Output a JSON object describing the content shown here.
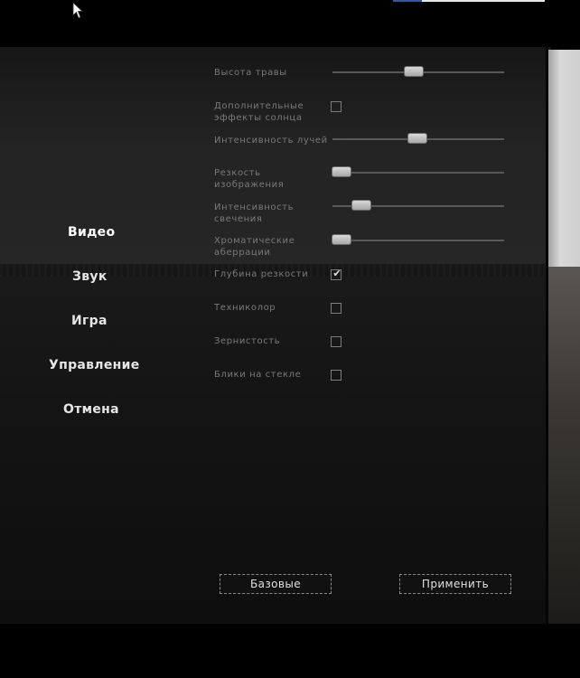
{
  "menu": {
    "items": [
      {
        "label": "Видео"
      },
      {
        "label": "Звук"
      },
      {
        "label": "Игра"
      },
      {
        "label": "Управление"
      },
      {
        "label": "Отмена"
      }
    ],
    "active": "Видео"
  },
  "settings": {
    "grass_height": {
      "label": "Высота травы",
      "value": 0.47
    },
    "sun_effects": {
      "label": "Дополнительные\nэффекты солнца",
      "checked": false
    },
    "ray_intensity": {
      "label": "Интенсивность лучей",
      "value": 0.5
    },
    "sharpness": {
      "label": "Резкость\nизображения",
      "value": 0.0
    },
    "glow_intensity": {
      "label": "Интенсивность\nсвечения",
      "value": 0.17
    },
    "chromatic_aberration": {
      "label": "Хроматические\nаберрации",
      "value": 0.0
    },
    "depth_of_field": {
      "label": "Глубина резкости",
      "checked": true
    },
    "technicolor": {
      "label": "Техниколор",
      "checked": false
    },
    "grain": {
      "label": "Зернистость",
      "checked": false
    },
    "lens_flares": {
      "label": "Блики на стекле",
      "checked": false
    }
  },
  "buttons": {
    "defaults_label": "Базовые",
    "apply_label": "Применить"
  },
  "colors": {
    "text_menu": "#e6e6e6",
    "text_label": "#7a7a7a",
    "accent": "#2c5a9c"
  }
}
